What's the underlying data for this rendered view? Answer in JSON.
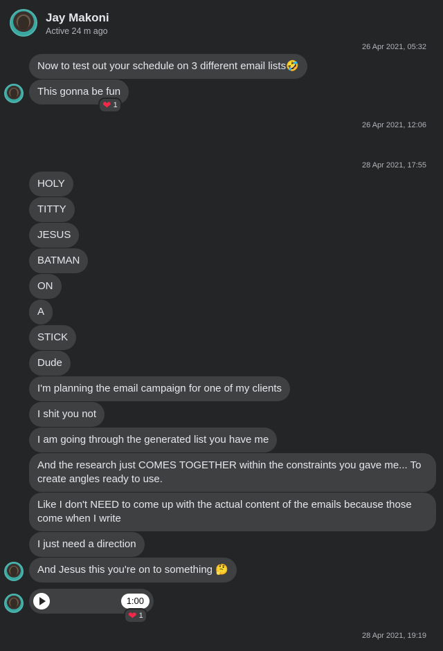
{
  "contact": {
    "name": "Jay Makoni",
    "status": "Active 24 m ago"
  },
  "timestamps": [
    "26 Apr 2021, 05:32",
    "26 Apr 2021, 12:06",
    "28 Apr 2021, 17:55",
    "28 Apr 2021, 19:19"
  ],
  "messages": [
    "Now to test out your schedule on 3 different email lists🤣",
    "This gonna be fun",
    "HOLY",
    "TITTY",
    "JESUS",
    "BATMAN",
    "ON",
    "A",
    "STICK",
    "Dude",
    "I'm planning the email campaign for one of my clients",
    "I shit you not",
    "I am going through the generated list you have me",
    "And the research just COMES TOGETHER within the constraints you gave me... To create angles ready to use.",
    "Like I don't NEED to come up with the actual content of the emails because those come when I write",
    "I just need a direction",
    "And Jesus this you're on to something 🤔"
  ],
  "reactions": [
    {
      "emoji": "heart-icon",
      "count": "1"
    },
    {
      "emoji": "heart-icon",
      "count": "1"
    }
  ],
  "audio": {
    "duration": "1:00"
  },
  "colors": {
    "background": "#242526",
    "bubble": "#3e4042",
    "heart": "#f02849"
  }
}
